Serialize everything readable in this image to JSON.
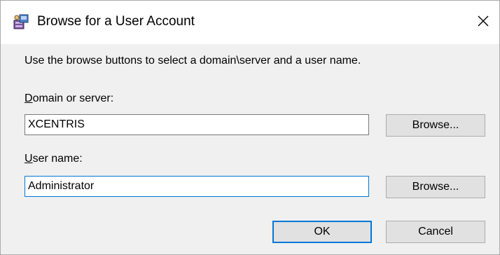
{
  "window": {
    "title": "Browse for a User Account",
    "title_icon": "user-account-browse-icon",
    "close_icon": "close-icon"
  },
  "instructions": "Use the browse buttons to select a domain\\server and a user name.",
  "domain": {
    "label_mnemonic": "D",
    "label_rest": "omain or server:",
    "value": "XCENTRIS",
    "browse_label": "Browse..."
  },
  "user": {
    "label_mnemonic": "U",
    "label_rest": "ser name:",
    "value": "Administrator",
    "browse_label": "Browse..."
  },
  "buttons": {
    "ok_label": "OK",
    "cancel_label": "Cancel"
  },
  "colors": {
    "accent": "#0078d7",
    "dialog_background": "#f0f0f0",
    "button_face": "#e1e1e1"
  }
}
